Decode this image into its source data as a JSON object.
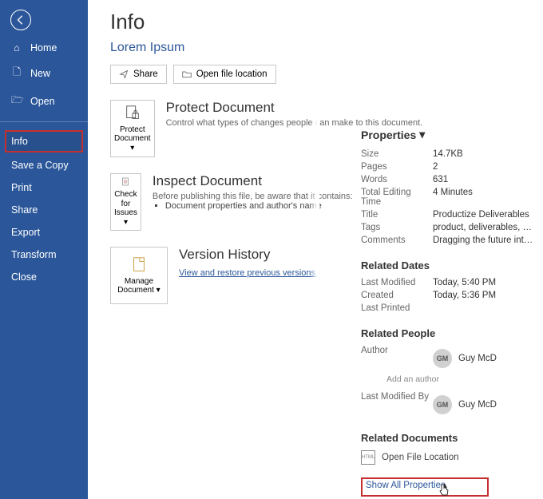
{
  "sidebar": {
    "items": [
      {
        "label": "Home"
      },
      {
        "label": "New"
      },
      {
        "label": "Open"
      },
      {
        "label": "Info"
      },
      {
        "label": "Save a Copy"
      },
      {
        "label": "Print"
      },
      {
        "label": "Share"
      },
      {
        "label": "Export"
      },
      {
        "label": "Transform"
      },
      {
        "label": "Close"
      }
    ]
  },
  "header": {
    "title": "Info",
    "doc_name": "Lorem Ipsum",
    "share_btn": "Share",
    "open_loc_btn": "Open file location"
  },
  "sections": {
    "protect": {
      "tile": "Protect Document",
      "title": "Protect Document",
      "desc": "Control what types of changes people can make to this document."
    },
    "inspect": {
      "tile": "Check for Issues",
      "title": "Inspect Document",
      "desc": "Before publishing this file, be aware that it contains:",
      "bullet": "Document properties and author's name"
    },
    "version": {
      "tile": "Manage Document",
      "title": "Version History",
      "link": "View and restore previous versions."
    }
  },
  "properties": {
    "header": "Properties",
    "size": {
      "k": "Size",
      "v": "14.7KB"
    },
    "pages": {
      "k": "Pages",
      "v": "2"
    },
    "words": {
      "k": "Words",
      "v": "631"
    },
    "edit_time": {
      "k": "Total Editing Time",
      "v": "4 Minutes"
    },
    "title": {
      "k": "Title",
      "v": "Productize Deliverables"
    },
    "tags": {
      "k": "Tags",
      "v": "product, deliverables, opti..."
    },
    "comments": {
      "k": "Comments",
      "v": "Dragging the future into n..."
    }
  },
  "related_dates": {
    "header": "Related Dates",
    "last_modified": {
      "k": "Last Modified",
      "v": "Today, 5:40 PM"
    },
    "created": {
      "k": "Created",
      "v": "Today, 5:36 PM"
    },
    "last_printed": {
      "k": "Last Printed",
      "v": ""
    }
  },
  "related_people": {
    "header": "Related People",
    "author_label": "Author",
    "author_initials": "GM",
    "author_name": "Guy McD",
    "add_author": "Add an author",
    "modified_label": "Last Modified By",
    "modified_initials": "GM",
    "modified_name": "Guy McD"
  },
  "related_docs": {
    "header": "Related Documents",
    "open_loc": "Open File Location",
    "show_all": "Show All Properties"
  }
}
